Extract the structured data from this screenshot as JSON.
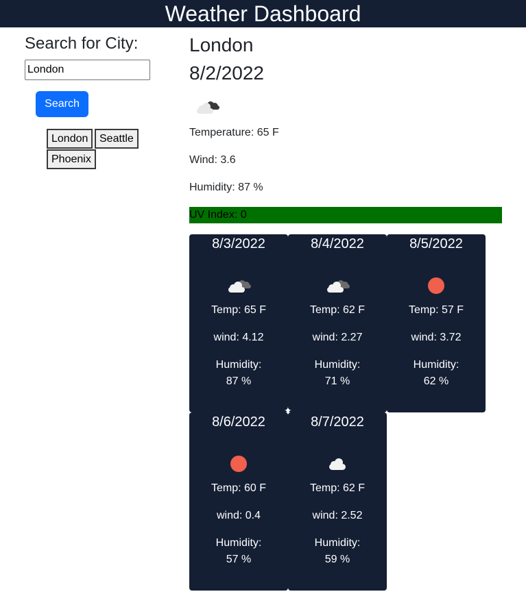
{
  "header": {
    "title": "Weather Dashboard"
  },
  "search": {
    "title": "Search for City:",
    "input_value": "London",
    "button_label": "Search",
    "history": [
      "London",
      "Seattle",
      "Phoenix"
    ]
  },
  "current": {
    "city": "London",
    "date": "8/2/2022",
    "icon": "cloudy-icon",
    "temperature": "Temperature: 65 F",
    "wind": "Wind: 3.6",
    "humidity": "Humidity: 87 %",
    "uv": "UV Index: 0",
    "uv_color": "#007000"
  },
  "forecast": [
    {
      "date": "8/3/2022",
      "icon": "broken-clouds-icon",
      "temp": "Temp: 65 F",
      "wind": "wind: 4.12",
      "humidity_label": "Humidity:",
      "humidity": "87 %"
    },
    {
      "date": "8/4/2022",
      "icon": "broken-clouds-icon",
      "temp": "Temp: 62 F",
      "wind": "wind: 2.27",
      "humidity_label": "Humidity:",
      "humidity": "71 %"
    },
    {
      "date": "8/5/2022",
      "icon": "clear-sun-icon",
      "temp": "Temp: 57 F",
      "wind": "wind: 3.72",
      "humidity_label": "Humidity:",
      "humidity": "62 %"
    },
    {
      "date": "8/6/2022",
      "icon": "clear-sun-icon",
      "temp": "Temp: 60 F",
      "wind": "wind: 0.4",
      "humidity_label": "Humidity:",
      "humidity": "57 %"
    },
    {
      "date": "8/7/2022",
      "icon": "cloud-icon",
      "temp": "Temp: 62 F",
      "wind": "wind: 2.52",
      "humidity_label": "Humidity:",
      "humidity": "59 %"
    }
  ],
  "colors": {
    "header_bg": "#141f34",
    "card_bg": "#141f34",
    "button_bg": "#0d6efd",
    "sun": "#f0604c"
  }
}
